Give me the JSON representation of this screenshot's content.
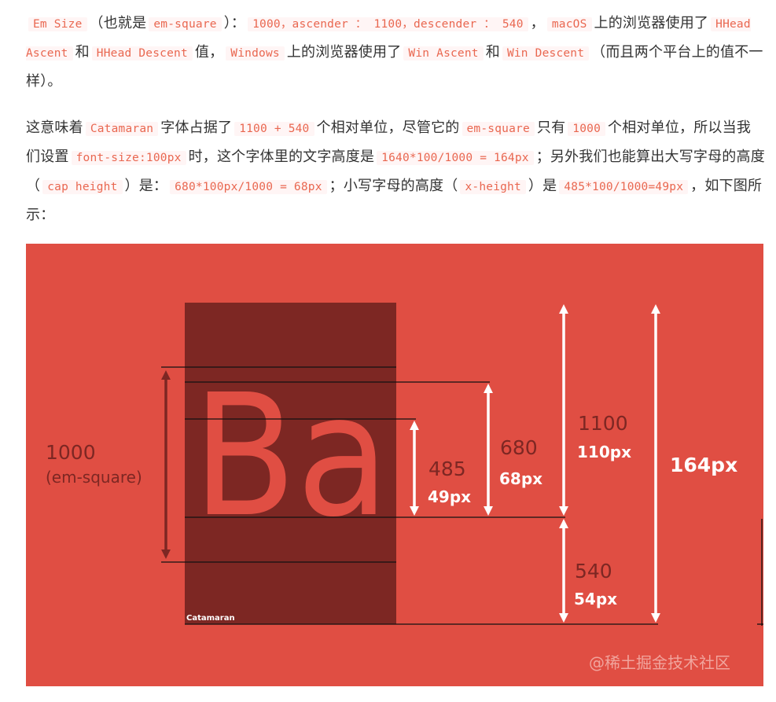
{
  "paragraph1": {
    "t1": "Em Size",
    "t2": "（也就是",
    "t3": "em-square",
    "t4": "）：",
    "t5": "1000，ascender ： 1100，descender ： 540",
    "t6": "，",
    "t7": "macOS",
    "t8": "上的浏览器使用了",
    "t9": "HHead Ascent",
    "t10": "和",
    "t11": "HHead Descent",
    "t12": "值，",
    "t13": "Windows",
    "t14": "上的浏览器使用了",
    "t15": "Win Ascent",
    "t16": "和",
    "t17": "Win Descent",
    "t18": "（而且两个平台上的值不一样）。"
  },
  "paragraph2": {
    "t1": "这意味着",
    "t2": "Catamaran",
    "t3": "字体占据了",
    "t4": "1100 + 540",
    "t5": "个相对单位，尽管它的",
    "t6": "em-square",
    "t7": "只有",
    "t8": "1000",
    "t9": "个相对单位，所以当我们设置",
    "t10": "font-size:100px",
    "t11": "时，这个字体里的文字高度是",
    "t12": "1640*100/1000 = 164px",
    "t13": "；另外我们也能算出大写字母的高度（",
    "t14": "cap height",
    "t15": "）是：",
    "t16": "680*100px/1000 = 68px",
    "t17": "；小写字母的高度（",
    "t18": "x-height",
    "t19": "）是",
    "t20": "485*100/1000=49px",
    "t21": "，如下图所示："
  },
  "figure": {
    "glyphs": "Ba",
    "font_label": "Catamaran",
    "em_value": "1000",
    "em_label": "(em-square)",
    "xheight_value": "485",
    "xheight_px": "49px",
    "cap_value": "680",
    "cap_px": "68px",
    "ascender_value": "1100",
    "ascender_px": "110px",
    "descender_value": "540",
    "descender_px": "54px",
    "total_px": "164px",
    "watermark": "@稀土掘金技术社区",
    "colors": {
      "background": "#e04e43",
      "em_box": "#7d2723",
      "label_dark": "#7d2723",
      "white": "#ffffff"
    }
  }
}
